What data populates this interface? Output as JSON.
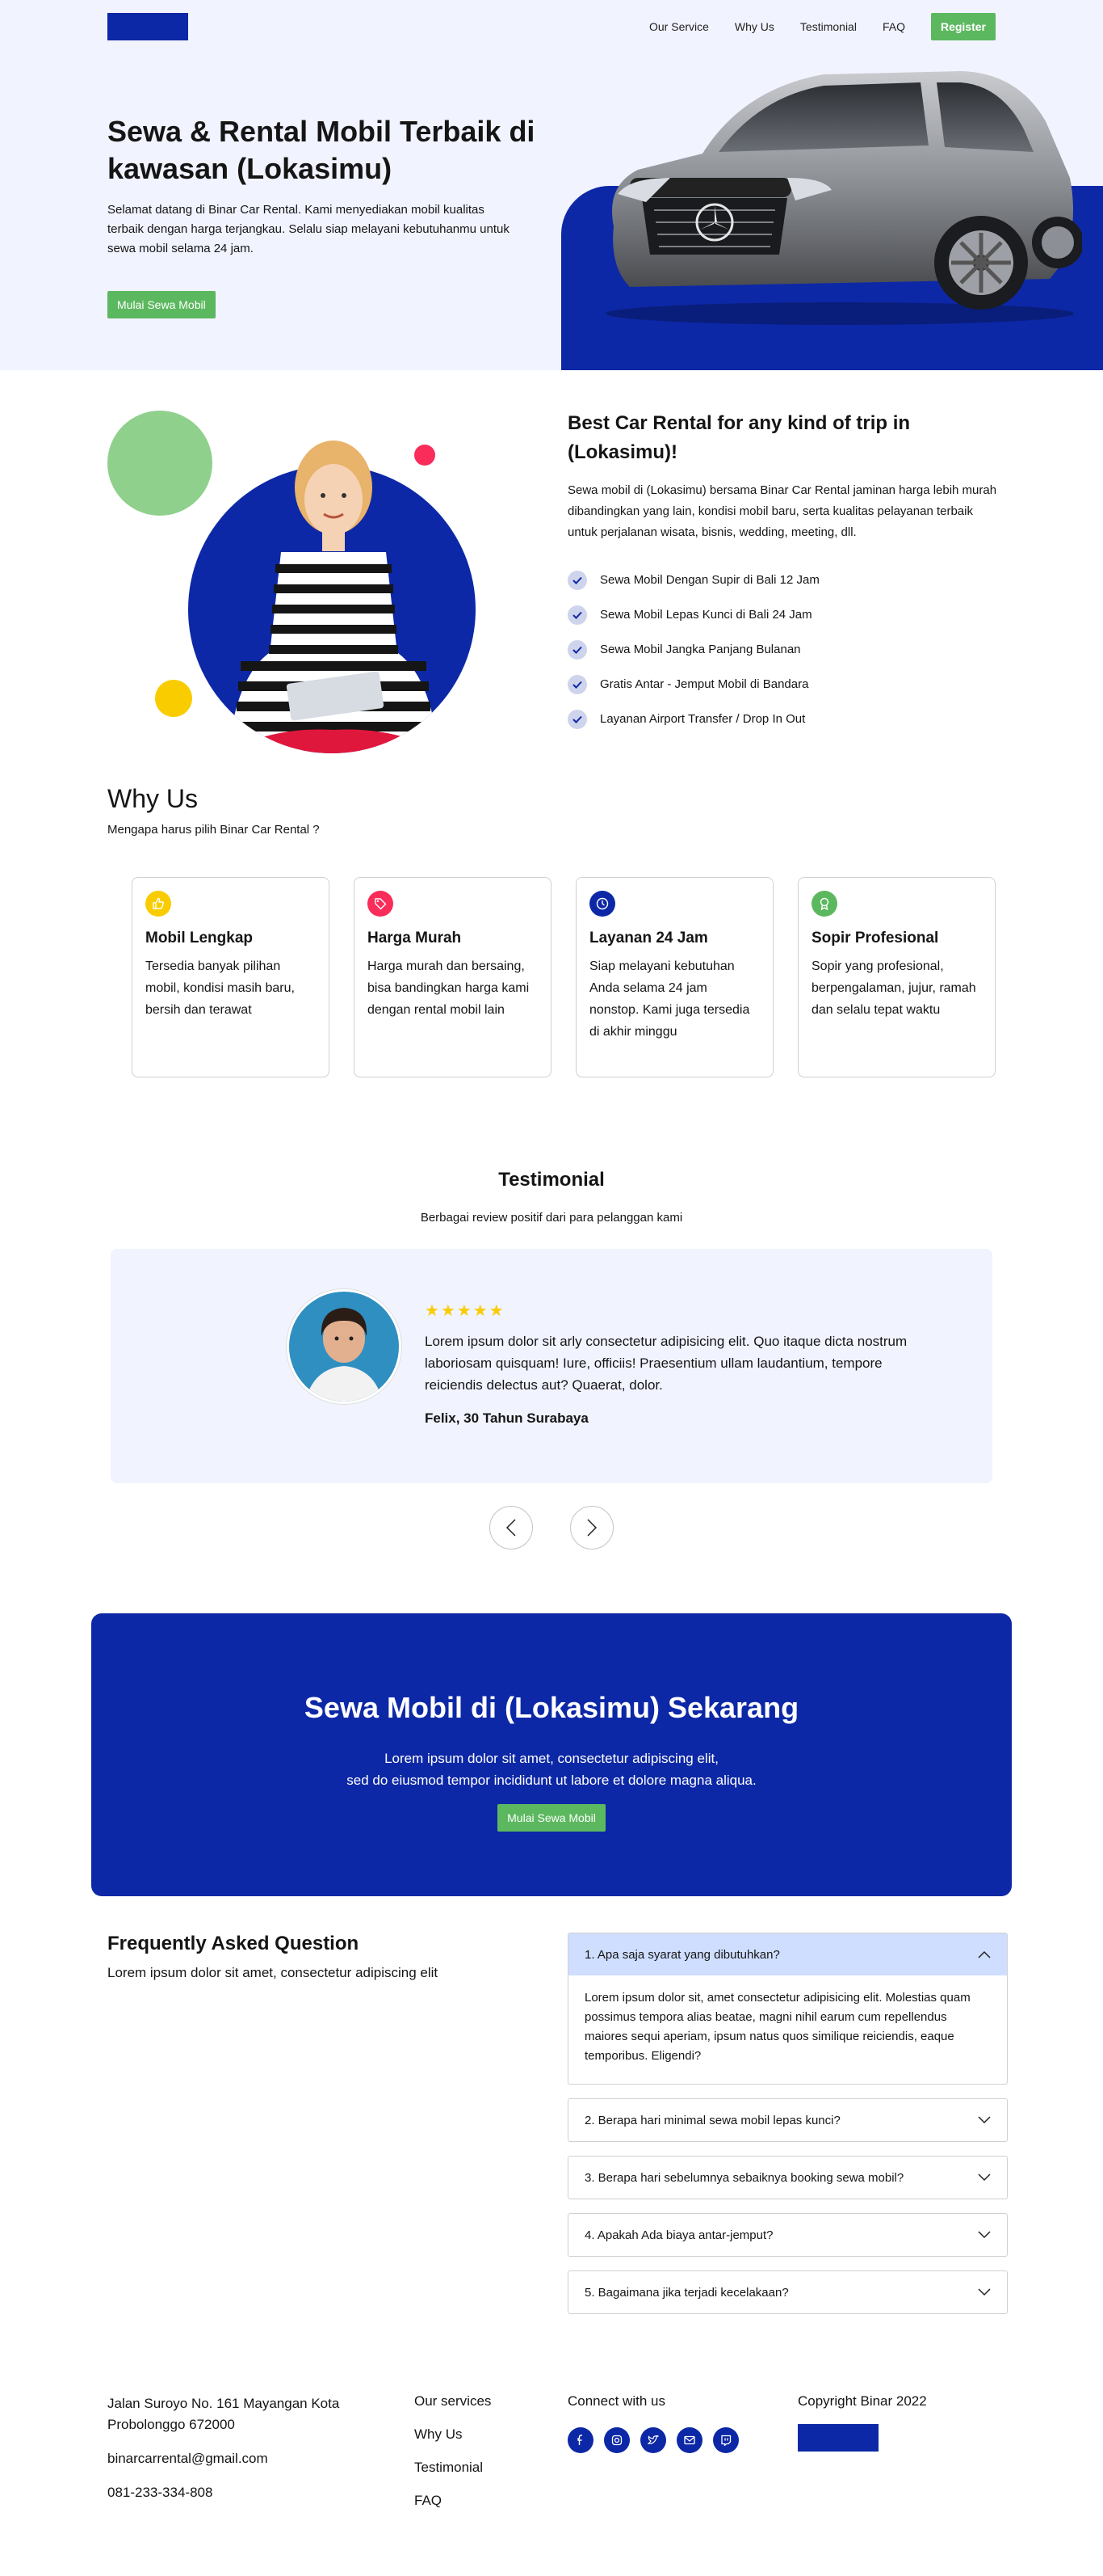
{
  "nav": {
    "links": [
      "Our Service",
      "Why Us",
      "Testimonial",
      "FAQ"
    ],
    "register_label": "Register"
  },
  "hero": {
    "title": "Sewa & Rental Mobil Terbaik di kawasan (Lokasimu)",
    "description": "Selamat datang di Binar Car Rental. Kami menyediakan mobil kualitas terbaik dengan harga terjangkau. Selalu siap melayani kebutuhanmu untuk sewa mobil selama 24 jam.",
    "cta_label": "Mulai Sewa Mobil",
    "image_icon": "car-image"
  },
  "services": {
    "title": "Best Car Rental for any kind of trip in (Lokasimu)!",
    "description": "Sewa mobil di (Lokasimu) bersama Binar Car Rental jaminan harga lebih murah dibandingkan yang lain, kondisi mobil baru, serta kualitas pelayanan terbaik untuk perjalanan wisata, bisnis, wedding, meeting, dll.",
    "items": [
      "Sewa Mobil Dengan Supir di Bali 12 Jam",
      "Sewa Mobil Lepas Kunci di Bali 24 Jam",
      "Sewa Mobil Jangka Panjang Bulanan",
      "Gratis Antar - Jemput Mobil di Bandara",
      "Layanan Airport Transfer / Drop In Out"
    ]
  },
  "why_us": {
    "title": "Why Us",
    "subtitle": "Mengapa harus pilih Binar Car Rental ?",
    "cards": [
      {
        "icon": "thumbs-up-icon",
        "color": "#F9CC00",
        "title": "Mobil Lengkap",
        "text": "Tersedia banyak pilihan mobil, kondisi masih baru, bersih dan terawat"
      },
      {
        "icon": "price-tag-icon",
        "color": "#FA2C5A",
        "title": "Harga Murah",
        "text": "Harga murah dan bersaing, bisa bandingkan harga kami dengan rental mobil lain"
      },
      {
        "icon": "clock-icon",
        "color": "#0D28A6",
        "title": "Layanan 24 Jam",
        "text": "Siap melayani kebutuhan Anda selama 24 jam nonstop. Kami juga tersedia di akhir minggu"
      },
      {
        "icon": "award-icon",
        "color": "#5CB85F",
        "title": "Sopir Profesional",
        "text": "Sopir yang profesional, berpengalaman, jujur, ramah dan selalu tepat waktu"
      }
    ]
  },
  "testimonial": {
    "title": "Testimonial",
    "subtitle": "Berbagai review positif dari para pelanggan kami",
    "rating": 5,
    "stars": "★★★★★",
    "text": "Lorem ipsum dolor sit arly consectetur adipisicing elit. Quo itaque dicta nostrum laboriosam quisquam! Iure, officiis! Praesentium ullam laudantium, tempore reiciendis delectus aut? Quaerat, dolor.",
    "author": "Felix, 30 Tahun Surabaya"
  },
  "cta": {
    "title": "Sewa Mobil di (Lokasimu) Sekarang",
    "line1": "Lorem ipsum dolor sit amet, consectetur adipiscing elit,",
    "line2": "sed do eiusmod tempor incididunt ut labore et dolore magna aliqua.",
    "button_label": "Mulai Sewa Mobil"
  },
  "faq": {
    "title": "Frequently Asked Question",
    "subtitle": "Lorem ipsum dolor sit amet, consectetur adipiscing elit",
    "items": [
      {
        "q": "1. Apa saja syarat yang dibutuhkan?",
        "a": "Lorem ipsum dolor sit, amet consectetur adipisicing elit. Molestias quam possimus tempora alias beatae, magni nihil earum cum repellendus maiores sequi aperiam, ipsum natus quos similique reiciendis, eaque temporibus. Eligendi?",
        "open": true
      },
      {
        "q": "2. Berapa hari minimal sewa mobil lepas kunci?",
        "open": false
      },
      {
        "q": "3. Berapa hari sebelumnya sebaiknya booking sewa mobil?",
        "open": false
      },
      {
        "q": "4. Apakah Ada biaya antar-jemput?",
        "open": false
      },
      {
        "q": "5. Bagaimana jika terjadi kecelakaan?",
        "open": false
      }
    ]
  },
  "footer": {
    "address": "Jalan Suroyo No. 161 Mayangan Kota Probolonggo 672000",
    "email": "binarcarrental@gmail.com",
    "phone": "081-233-334-808",
    "links": [
      "Our services",
      "Why Us",
      "Testimonial",
      "FAQ"
    ],
    "connect_label": "Connect with us",
    "socials": [
      "facebook-icon",
      "instagram-icon",
      "twitter-icon",
      "mail-icon",
      "twitch-icon"
    ],
    "copyright": "Copyright Binar 2022"
  }
}
